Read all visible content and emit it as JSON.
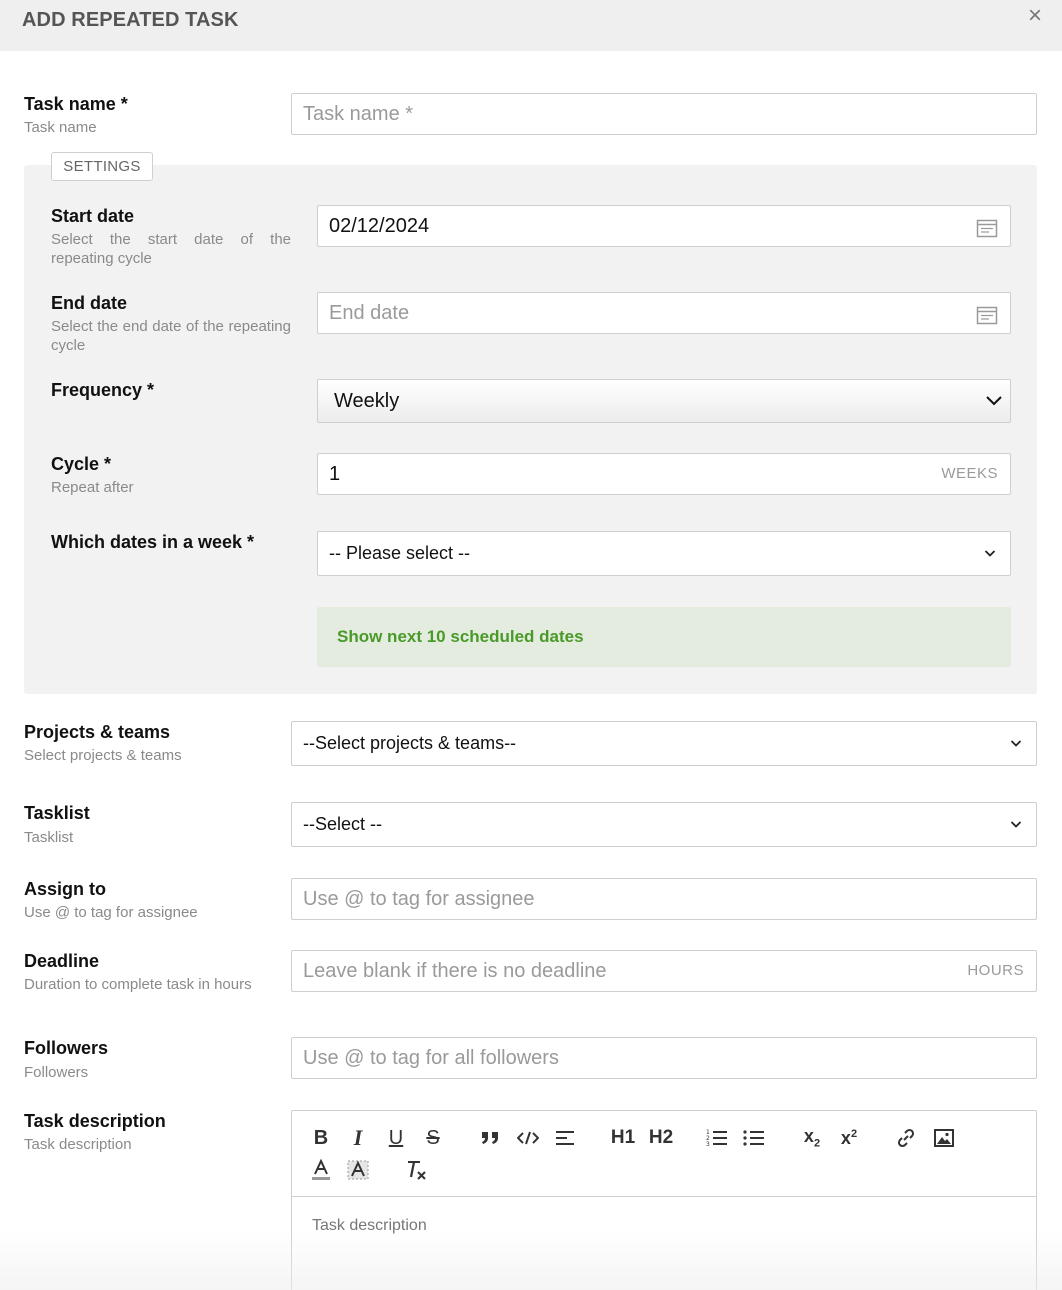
{
  "dialog": {
    "title": "ADD REPEATED TASK",
    "close_label": "×"
  },
  "task_name": {
    "label": "Task name *",
    "sub": "Task name",
    "placeholder": "Task name *"
  },
  "settings": {
    "tag": "SETTINGS",
    "start_date": {
      "label": "Start date",
      "sub": "Select the start date of the repeating cycle",
      "value": "02/12/2024"
    },
    "end_date": {
      "label": "End date",
      "sub": "Select the end date of the repeating cycle",
      "placeholder": "End date"
    },
    "frequency": {
      "label": "Frequency *",
      "value": "Weekly"
    },
    "cycle": {
      "label": "Cycle *",
      "sub": "Repeat after",
      "value": "1",
      "suffix": "WEEKS"
    },
    "week_dates": {
      "label": "Which dates in a week *",
      "value": "-- Please select --"
    },
    "show_dates": "Show next 10 scheduled dates"
  },
  "projects": {
    "label": "Projects & teams",
    "sub": "Select projects & teams",
    "value": "--Select projects & teams--"
  },
  "tasklist": {
    "label": "Tasklist",
    "sub": "Tasklist",
    "value": "--Select --"
  },
  "assign": {
    "label": "Assign to",
    "sub": "Use @ to tag for assignee",
    "placeholder": "Use @ to tag for assignee"
  },
  "deadline": {
    "label": "Deadline",
    "sub": "Duration to complete task in hours",
    "placeholder": "Leave blank if there is no deadline",
    "suffix": "HOURS"
  },
  "followers": {
    "label": "Followers",
    "sub": "Followers",
    "placeholder": "Use @ to tag for all followers"
  },
  "description": {
    "label": "Task description",
    "sub": "Task description",
    "placeholder": "Task description",
    "toolbar": {
      "bold": "B",
      "italic": "I",
      "underline": "U",
      "strike": "S",
      "h1": "H1",
      "h2": "H2",
      "subscript": "x2",
      "superscript": "x2",
      "clear_format": "Tx"
    }
  }
}
